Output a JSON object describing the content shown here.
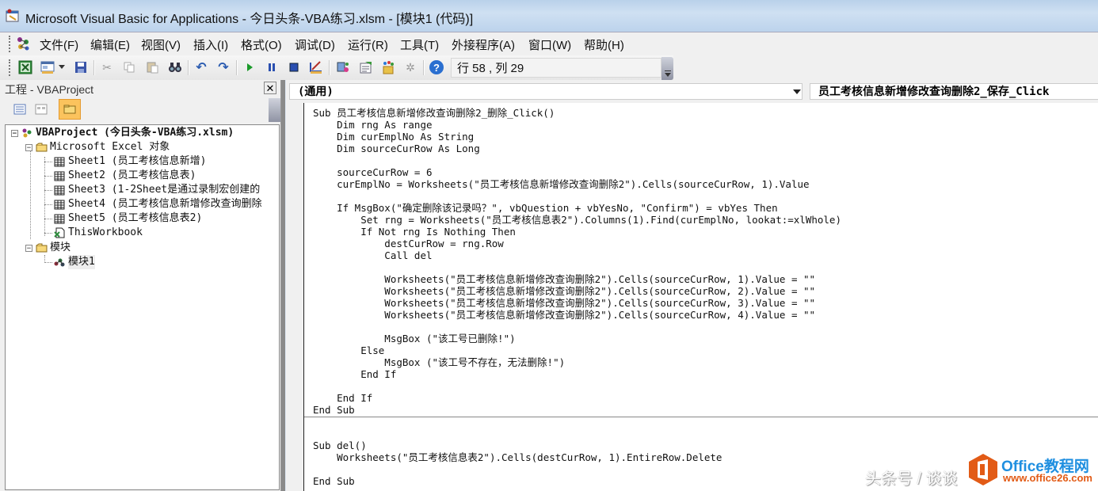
{
  "window": {
    "title": "Microsoft Visual Basic for Applications - 今日头条-VBA练习.xlsm - [模块1 (代码)]"
  },
  "menu": {
    "items": [
      {
        "label": "文件(F)"
      },
      {
        "label": "编辑(E)"
      },
      {
        "label": "视图(V)"
      },
      {
        "label": "插入(I)"
      },
      {
        "label": "格式(O)"
      },
      {
        "label": "调试(D)"
      },
      {
        "label": "运行(R)"
      },
      {
        "label": "工具(T)"
      },
      {
        "label": "外接程序(A)"
      },
      {
        "label": "窗口(W)"
      },
      {
        "label": "帮助(H)"
      }
    ]
  },
  "toolbar": {
    "buttons": [
      {
        "icon": "view-excel-icon"
      },
      {
        "icon": "insert-userform-icon"
      },
      {
        "icon": "dropdown-arrow-icon"
      },
      {
        "icon": "save-icon"
      },
      {
        "icon": "cut-icon"
      },
      {
        "icon": "copy-icon"
      },
      {
        "icon": "paste-icon"
      },
      {
        "icon": "find-icon"
      },
      {
        "icon": "undo-icon"
      },
      {
        "icon": "redo-icon"
      },
      {
        "icon": "run-icon"
      },
      {
        "icon": "break-icon"
      },
      {
        "icon": "reset-icon"
      },
      {
        "icon": "design-mode-icon"
      },
      {
        "icon": "project-explorer-icon"
      },
      {
        "icon": "properties-window-icon"
      },
      {
        "icon": "object-browser-icon"
      },
      {
        "icon": "toolbox-icon"
      },
      {
        "icon": "help-icon"
      }
    ],
    "position_status": "行 58 , 列 29"
  },
  "project_pane": {
    "title": "工程 - VBAProject",
    "close_label": "✕",
    "tools": [
      {
        "icon": "view-code-icon"
      },
      {
        "icon": "view-object-icon"
      },
      {
        "icon": "toggle-folders-icon",
        "active": true
      }
    ],
    "tree": [
      {
        "label": "VBAProject (今日头条-VBA练习.xlsm)",
        "level": 0,
        "icon": "vbaproject-icon",
        "expander": "−",
        "bold": true
      },
      {
        "label": "Microsoft Excel 对象",
        "level": 1,
        "icon": "folder-icon",
        "expander": "−"
      },
      {
        "label": "Sheet1 (员工考核信息新增)",
        "level": 2,
        "icon": "sheet-icon"
      },
      {
        "label": "Sheet2 (员工考核信息表)",
        "level": 2,
        "icon": "sheet-icon"
      },
      {
        "label": "Sheet3 (1-2Sheet是通过录制宏创建的",
        "level": 2,
        "icon": "sheet-icon"
      },
      {
        "label": "Sheet4 (员工考核信息新增修改查询删除",
        "level": 2,
        "icon": "sheet-icon"
      },
      {
        "label": "Sheet5 (员工考核信息表2)",
        "level": 2,
        "icon": "sheet-icon"
      },
      {
        "label": "ThisWorkbook",
        "level": 2,
        "icon": "workbook-icon"
      },
      {
        "label": "模块",
        "level": 1,
        "icon": "folder-icon",
        "expander": "−"
      },
      {
        "label": "模块1",
        "level": 2,
        "icon": "module-icon",
        "selected": true
      }
    ]
  },
  "code_window": {
    "object_combo": "(通用)",
    "procedure_combo": "员工考核信息新增修改查询删除2_保存_Click",
    "lines": [
      "Sub 员工考核信息新增修改查询删除2_删除_Click()",
      "    Dim rng As range",
      "    Dim curEmplNo As String",
      "    Dim sourceCurRow As Long",
      "",
      "    sourceCurRow = 6",
      "    curEmplNo = Worksheets(\"员工考核信息新增修改查询删除2\").Cells(sourceCurRow, 1).Value",
      "",
      "    If MsgBox(\"确定删除该记录吗？\", vbQuestion + vbYesNo, \"Confirm\") = vbYes Then",
      "        Set rng = Worksheets(\"员工考核信息表2\").Columns(1).Find(curEmplNo, lookat:=xlWhole)",
      "        If Not rng Is Nothing Then",
      "            destCurRow = rng.Row",
      "            Call del",
      "",
      "            Worksheets(\"员工考核信息新增修改查询删除2\").Cells(sourceCurRow, 1).Value = \"\"",
      "            Worksheets(\"员工考核信息新增修改查询删除2\").Cells(sourceCurRow, 2).Value = \"\"",
      "            Worksheets(\"员工考核信息新增修改查询删除2\").Cells(sourceCurRow, 3).Value = \"\"",
      "            Worksheets(\"员工考核信息新增修改查询删除2\").Cells(sourceCurRow, 4).Value = \"\"",
      "",
      "            MsgBox (\"该工号已删除!\")",
      "        Else",
      "            MsgBox (\"该工号不存在，无法删除!\")",
      "        End If",
      "",
      "    End If",
      "End Sub",
      "",
      "",
      "Sub del()",
      "    Worksheets(\"员工考核信息表2\").Cells(destCurRow, 1).EntireRow.Delete",
      "",
      "End Sub"
    ],
    "separator_after_line": 25
  },
  "watermark": {
    "text": "头条号 / 谈谈",
    "brand": "Office教程网",
    "url": "www.office26.com",
    "brand_color": "#1f8fe0",
    "logo_color": "#e25b16"
  }
}
